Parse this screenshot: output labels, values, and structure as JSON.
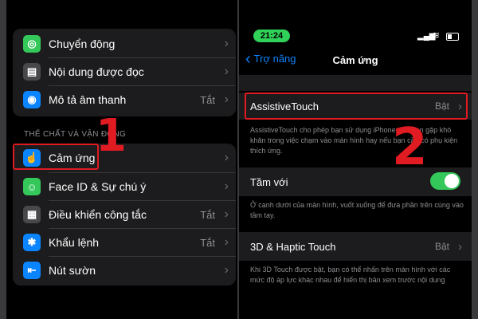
{
  "left": {
    "top_group": [
      {
        "icon": "motion-icon",
        "label": "Chuyển động",
        "value": "",
        "color": "#34c759"
      },
      {
        "icon": "spoken-content-icon",
        "label": "Nội dung được đọc",
        "value": "",
        "color": "#3a3a3c"
      },
      {
        "icon": "audio-description-icon",
        "label": "Mô tả âm thanh",
        "value": "Tắt",
        "color": "#0a84ff"
      }
    ],
    "section_header": "THỂ CHẤT VÀ VẬN ĐỘNG",
    "bottom_group": [
      {
        "icon": "touch-icon",
        "label": "Cảm ứng",
        "value": "",
        "color": "#0a84ff"
      },
      {
        "icon": "face-id-icon",
        "label": "Face ID & Sự chú ý",
        "value": "",
        "color": "#34c759"
      },
      {
        "icon": "switch-control-icon",
        "label": "Điều khiển công tắc",
        "value": "Tắt",
        "color": "#3a3a3c"
      },
      {
        "icon": "voice-control-icon",
        "label": "Khẩu lệnh",
        "value": "Tắt",
        "color": "#0a84ff"
      },
      {
        "icon": "side-button-icon",
        "label": "Nút sườn",
        "value": "",
        "color": "#0a84ff"
      }
    ],
    "annotation_number": "1"
  },
  "right": {
    "status_time": "21:24",
    "back_label": "Trợ năng",
    "title": "Cảm ứng",
    "assistive_touch": {
      "label": "AssistiveTouch",
      "value": "Bật"
    },
    "assistive_desc": "AssistiveTouch cho phép bạn sử dụng iPhone nếu bạn gặp khó khăn trong việc chạm vào màn hình hay nếu bạn cần có phụ kiện thích ứng.",
    "reachability": {
      "label": "Tầm với",
      "on": true
    },
    "reachability_desc": "Ở cạnh dưới của màn hình, vuốt xuống để đưa phần trên cùng vào tầm tay.",
    "haptic": {
      "label": "3D & Haptic Touch",
      "value": "Bật"
    },
    "haptic_desc": "Khi 3D Touch được bật, bạn có thể nhấn trên màn hình với các mức độ áp lực khác nhau để hiển thị bản xem trước nội dung",
    "annotation_number": "2",
    "accent": "#0a84ff",
    "toggle_color": "#34c759"
  },
  "highlight_color": "#e01b22"
}
